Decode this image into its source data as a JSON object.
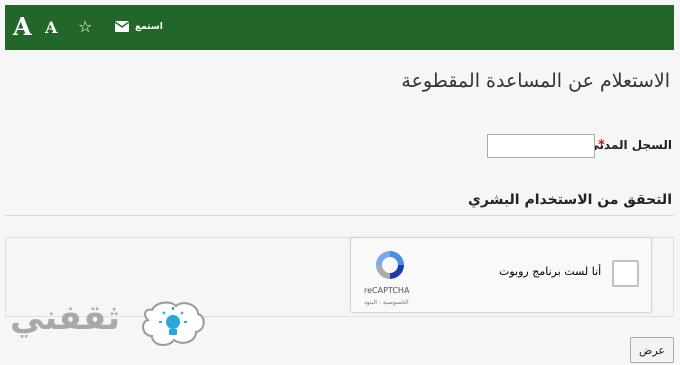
{
  "toolbar": {
    "font_increase_label": "A",
    "font_decrease_label": "A",
    "favorite_glyph": "☆",
    "listen_label": "استمع",
    "bg_color": "#23662a"
  },
  "form": {
    "title": "الاستعلام عن المساعدة المقطوعة",
    "civil_id_label": "السجل المدني",
    "required_mark": "*",
    "civil_id_value": "",
    "verification_heading": "التحقق من الاستخدام البشري",
    "submit_label": "عرض"
  },
  "recaptcha": {
    "checkbox_label": "أنا لست برنامج روبوت",
    "brand": "reCAPTCHA",
    "links": "الخصوصية - البنود"
  },
  "watermark": {
    "text": "ثقفني"
  }
}
